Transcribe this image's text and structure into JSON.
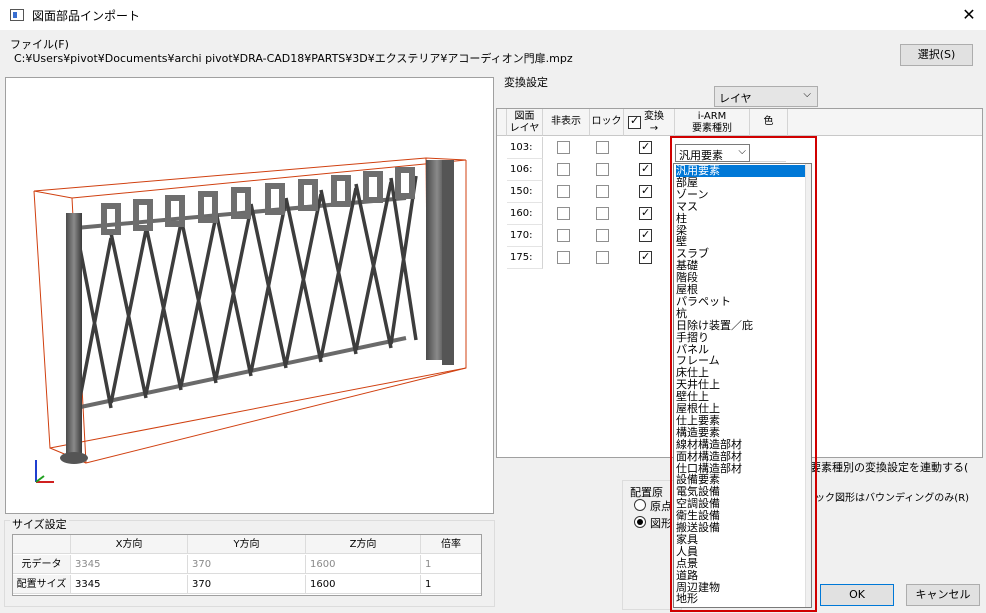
{
  "window": {
    "title": "図面部品インポート",
    "close": "✕"
  },
  "file": {
    "label": "ファイル(F)",
    "path": "C:¥Users¥pivot¥Documents¥archi pivot¥DRA-CAD18¥PARTS¥3D¥エクステリア¥アコーディオン門扉.mpz",
    "select_button": "選択(S)"
  },
  "conversion": {
    "title": "変換設定",
    "layer_combo": "レイヤ",
    "headers": {
      "layer": "図面\nレイヤ",
      "hide": "非表示",
      "lock": "ロック",
      "convert": "変換\n→",
      "element_type": "i-ARM\n要素種別",
      "color": "色"
    },
    "rows": [
      {
        "layer": "103:",
        "hide": false,
        "lock": false,
        "convert": true
      },
      {
        "layer": "106:",
        "hide": false,
        "lock": false,
        "convert": true
      },
      {
        "layer": "150:",
        "hide": false,
        "lock": false,
        "convert": true
      },
      {
        "layer": "160:",
        "hide": false,
        "lock": false,
        "convert": true
      },
      {
        "layer": "170:",
        "hide": false,
        "lock": false,
        "convert": true
      },
      {
        "layer": "175:",
        "hide": false,
        "lock": false,
        "convert": true
      }
    ],
    "current_type": "汎用要素",
    "dropdown_options": [
      "汎用要素",
      "部屋",
      "ゾーン",
      "マス",
      "柱",
      "梁",
      "壁",
      "スラブ",
      "基礎",
      "階段",
      "屋根",
      "パラペット",
      "杭",
      "日除け装置／庇",
      "手摺り",
      "パネル",
      "フレーム",
      "床仕上",
      "天井仕上",
      "壁仕上",
      "屋根仕上",
      "仕上要素",
      "構造要素",
      "線材構造部材",
      "面材構造部材",
      "仕口構造部材",
      "設備要素",
      "電気設備",
      "空調設備",
      "衛生設備",
      "搬送設備",
      "家具",
      "人員",
      "点景",
      "道路",
      "周辺建物",
      "地形"
    ],
    "link_option": "要素種別の変換設定を連動する(",
    "bounding_option": "ック図形はバウンディングのみ(R)"
  },
  "placement": {
    "label": "配置原",
    "origin": "原点",
    "shape": "図形"
  },
  "size": {
    "title": "サイズ設定",
    "headers": [
      "",
      "X方向",
      "Y方向",
      "Z方向",
      "倍率"
    ],
    "rows": [
      {
        "label": "元データ",
        "x": "3345",
        "y": "370",
        "z": "1600",
        "scale": "1"
      },
      {
        "label": "配置サイズ",
        "x": "3345",
        "y": "370",
        "z": "1600",
        "scale": "1"
      }
    ]
  },
  "buttons": {
    "ok": "OK",
    "cancel": "キャンセル"
  },
  "colors": {
    "selection": "#0078d7",
    "highlight": "#d00000",
    "bbox": "#d04010"
  }
}
